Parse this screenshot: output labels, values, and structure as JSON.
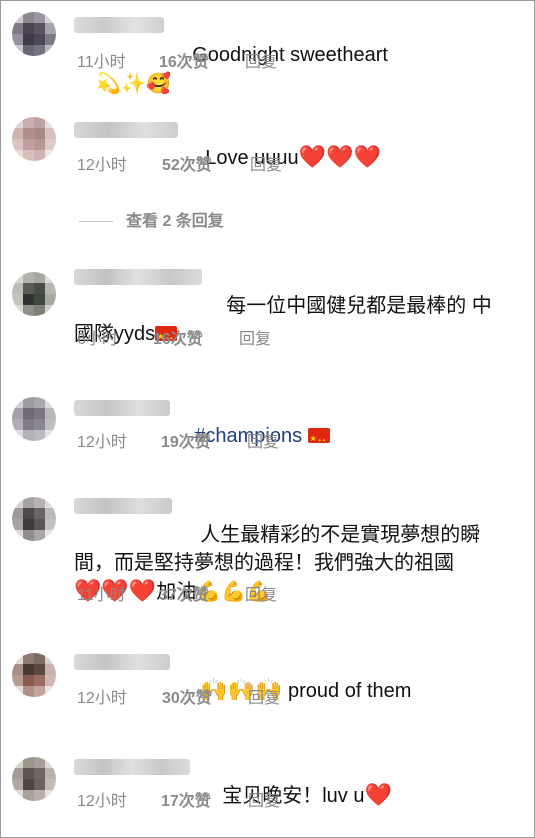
{
  "comments": [
    {
      "text": "Goodnight sweetheart",
      "emojis": [
        "💫",
        "✨",
        "🥰"
      ],
      "time": "11小时",
      "likes": "16次赞",
      "reply": "回复"
    },
    {
      "text": "Love uuuu",
      "emojis": [
        "❤️",
        "❤️",
        "❤️"
      ],
      "time": "12小时",
      "likes": "52次赞",
      "reply": "回复"
    },
    {
      "text_line1": "每一位中國健兒都是最棒的 中",
      "text_line2": "國隊yyds",
      "emojis": [
        "🇨🇳"
      ],
      "time": "6小时",
      "likes": "16次赞",
      "reply": "回复"
    },
    {
      "text": "#champions",
      "emojis": [
        "🇨🇳"
      ],
      "time": "12小时",
      "likes": "19次赞",
      "reply": "回复"
    },
    {
      "text_line1": "人生最精彩的不是實現夢想的瞬",
      "text_line2": "間，而是堅持夢想的過程！我們強大的祖國",
      "text_line3": "加油",
      "emojis": [
        "❤️",
        "❤️",
        "❤️",
        "💪",
        "💪",
        "💪"
      ],
      "time": "11小时",
      "likes": "37次赞",
      "reply": "回复"
    },
    {
      "text": "proud of them",
      "emojis": [
        "🙌",
        "🙌",
        "🙌"
      ],
      "time": "12小时",
      "likes": "30次赞",
      "reply": "回复"
    },
    {
      "text": "宝贝晚安！luv u",
      "emojis": [
        "❤️"
      ],
      "time": "12小时",
      "likes": "17次赞",
      "reply": "回复"
    }
  ],
  "view_replies": "查看 2 条回复",
  "colors": {
    "meta_gray": "#8a8a8a",
    "hashtag_blue": "#1f3f7a",
    "heart_red": "#e0202a"
  }
}
